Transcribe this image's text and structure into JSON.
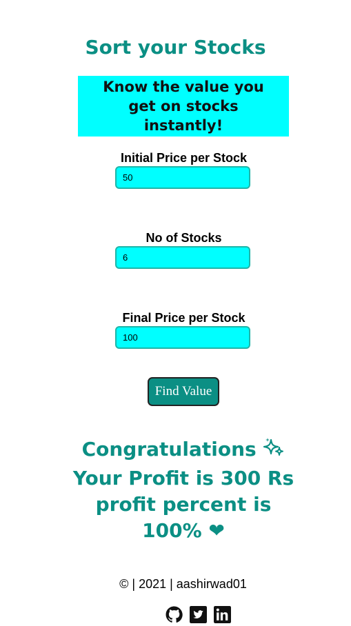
{
  "header": {
    "title": "Sort your Stocks"
  },
  "banner": {
    "text": "Know the value you get on stocks instantly!"
  },
  "form": {
    "initial_label": "Initial Price per Stock",
    "initial_value": "50",
    "quantity_label": "No of Stocks",
    "quantity_value": "6",
    "final_label": "Final Price per Stock",
    "final_value": "100",
    "submit_label": "Find Value"
  },
  "result": {
    "line1": "Congratulations",
    "line2": "Your Profit is 300 Rs profit percent is 100%",
    "sparkle_icon": "sparkle-icon",
    "heart_icon": "heart-icon"
  },
  "footer": {
    "text": "© | 2021 | aashirwad01",
    "links": [
      "github-icon",
      "twitter-icon",
      "linkedin-icon"
    ]
  },
  "colors": {
    "accent": "#0b8f84",
    "highlight": "#00ffff"
  }
}
